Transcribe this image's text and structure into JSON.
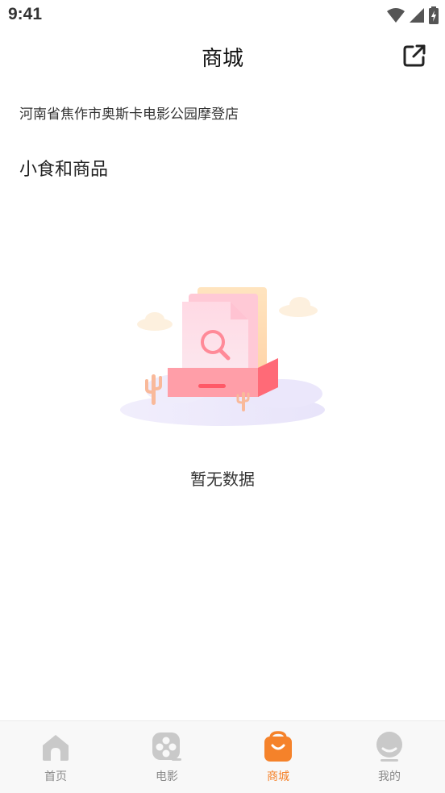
{
  "status_bar": {
    "time": "9:41"
  },
  "header": {
    "title": "商城"
  },
  "cinema": {
    "name": "河南省焦作市奥斯卡电影公园摩登店"
  },
  "section": {
    "title": "小食和商品"
  },
  "empty_state": {
    "text": "暂无数据"
  },
  "tab_bar": {
    "items": [
      {
        "label": "首页",
        "icon": "home-icon",
        "active": false
      },
      {
        "label": "电影",
        "icon": "film-reel-icon",
        "active": false
      },
      {
        "label": "商城",
        "icon": "shopping-bag-icon",
        "active": true
      },
      {
        "label": "我的",
        "icon": "profile-icon",
        "active": false
      }
    ]
  },
  "colors": {
    "accent": "#f5822a",
    "inactive": "#c8c8c8"
  }
}
